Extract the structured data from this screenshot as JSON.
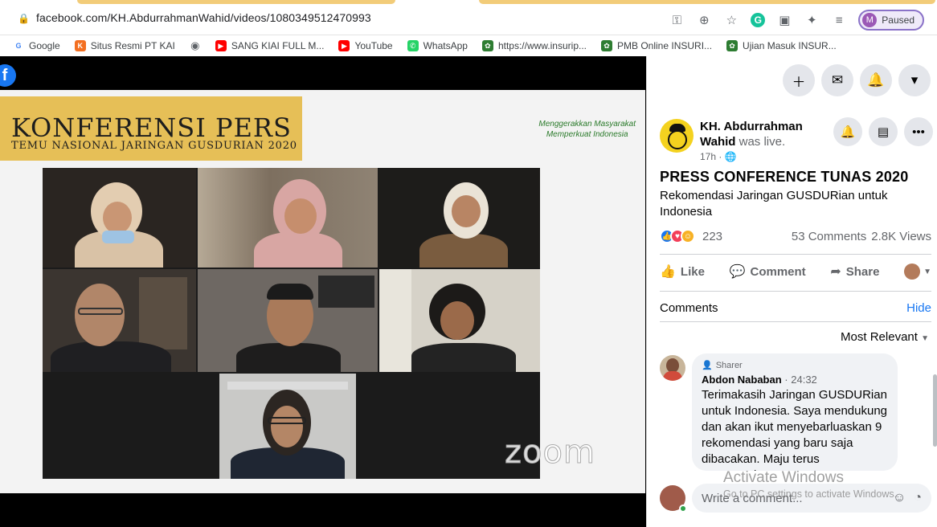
{
  "browser": {
    "url": "facebook.com/KH.AbdurrahmanWahid/videos/1080349512470993",
    "profile_initial": "M",
    "profile_status": "Paused",
    "bookmarks": [
      {
        "label": "Google",
        "icon": "google-icon",
        "color": "#4285f4"
      },
      {
        "label": "Situs Resmi PT KAI",
        "icon": "kai-icon",
        "color": "#f36f21"
      },
      {
        "label": "",
        "icon": "globe-icon",
        "color": "#5f6368"
      },
      {
        "label": "SANG KIAI FULL M...",
        "icon": "youtube-icon",
        "color": "#ff0000"
      },
      {
        "label": "YouTube",
        "icon": "youtube-icon",
        "color": "#ff0000"
      },
      {
        "label": "WhatsApp",
        "icon": "whatsapp-icon",
        "color": "#25d366"
      },
      {
        "label": "https://www.insurip...",
        "icon": "insuri-icon",
        "color": "#2e7d32"
      },
      {
        "label": "PMB Online INSURI...",
        "icon": "insuri-icon",
        "color": "#2e7d32"
      },
      {
        "label": "Ujian Masuk INSUR...",
        "icon": "insuri-icon",
        "color": "#2e7d32"
      }
    ]
  },
  "video": {
    "banner_title": "KONFERENSI PERS",
    "banner_subtitle": "TEMU NASIONAL JARINGAN GUSDURIAN 2020",
    "tagline_line1": "Menggerakkan Masyarakat",
    "tagline_line2": "Memperkuat Indonesia",
    "zoom_logo": "zoom",
    "fb_badge": "f"
  },
  "post": {
    "page_name": "KH. Abdurrahman Wahid",
    "status_text": "was live.",
    "time": "17h · ",
    "title": "PRESS CONFERENCE TUNAS 2020",
    "description": "Rekomendasi Jaringan GUSDURian untuk Indonesia",
    "reaction_count": "223",
    "comments_count": "53 Comments",
    "views_count": "2.8K Views",
    "actions": {
      "like": "Like",
      "comment": "Comment",
      "share": "Share"
    }
  },
  "comments_section": {
    "heading": "Comments",
    "hide_label": "Hide",
    "sort_label": "Most Relevant",
    "items": [
      {
        "role": "Sharer",
        "author": "Abdon Nababan",
        "time": "24:32",
        "text": "Terimakasih Jaringan GUSDURian untuk Indonesia. Saya mendukung dan akan ikut menyebarluaskan 9 rekomendasi yang baru saja dibacakan. Maju terus GUSDURian..."
      }
    ],
    "input_placeholder": "Write a comment..."
  },
  "watermark": {
    "line1": "Activate Windows",
    "line2": "Go to PC settings to activate Windows."
  },
  "colors": {
    "fb_blue": "#1877f2",
    "banner_gold": "#e6bf57",
    "like_blue": "#1877f2",
    "love_red": "#f33e58",
    "care_yellow": "#f7b125"
  }
}
